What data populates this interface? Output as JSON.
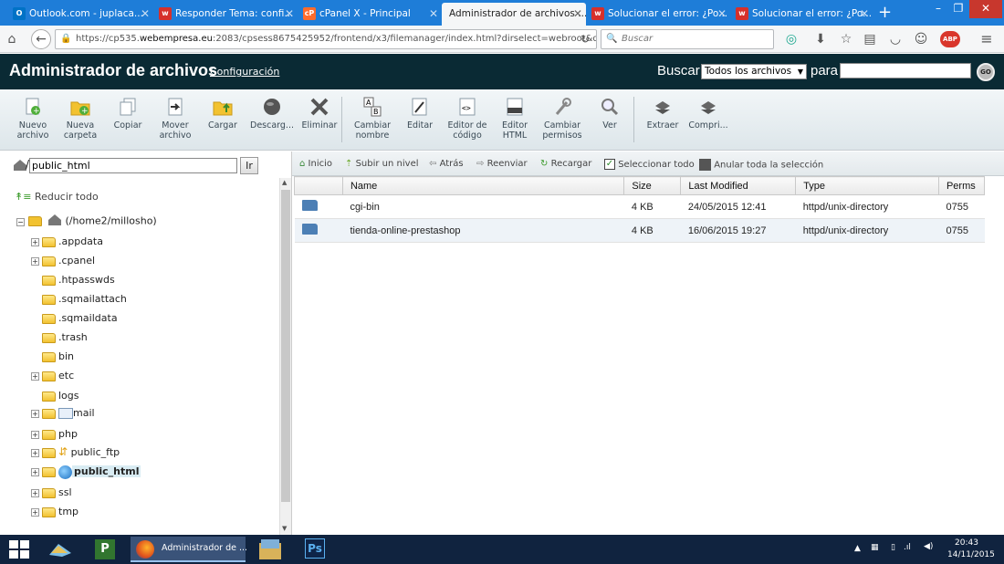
{
  "browser": {
    "tabs": [
      {
        "label": "Outlook.com - juplaca...",
        "favicon": "outlook-icon",
        "color": "#0072c6"
      },
      {
        "label": "Responder Tema: confi...",
        "favicon": "webempresa-icon",
        "color": "#d6302b"
      },
      {
        "label": "cPanel X - Principal",
        "favicon": "cpanel-icon",
        "color": "#ff6c2c"
      },
      {
        "label": "Administrador de archivos ...",
        "favicon": "none",
        "color": "#f5f6f7"
      },
      {
        "label": "Solucionar el error: ¿Po...",
        "favicon": "webempresa-icon",
        "color": "#d6302b"
      },
      {
        "label": "Solucionar el error: ¿Po...",
        "favicon": "webempresa-icon",
        "color": "#d6302b"
      }
    ],
    "url_prefix": "https://cp535.",
    "url_domain": "webempresa.eu",
    "url_suffix": ":2083/cpsess8675425952/frontend/x3/filemanager/index.html?dirselect=webroot&domainsele",
    "search_placeholder": "Buscar"
  },
  "header": {
    "title": "Administrador de archivos",
    "config_link": "Configuración",
    "search_label": "Buscar",
    "search_scope": "Todos los archivos",
    "search_para": "para",
    "go_label": "GO"
  },
  "toolbar": [
    {
      "label1": "Nuevo",
      "label2": "archivo",
      "icon": "new-file-icon"
    },
    {
      "label1": "Nueva",
      "label2": "carpeta",
      "icon": "new-folder-icon"
    },
    {
      "label1": "Copiar",
      "label2": "",
      "icon": "copy-icon"
    },
    {
      "label1": "Mover",
      "label2": "archivo",
      "icon": "move-icon"
    },
    {
      "label1": "Cargar",
      "label2": "",
      "icon": "upload-icon"
    },
    {
      "label1": "Descarg...",
      "label2": "",
      "icon": "download-icon"
    },
    {
      "label1": "Eliminar",
      "label2": "",
      "icon": "delete-icon"
    },
    {
      "label1": "Cambiar",
      "label2": "nombre",
      "icon": "rename-icon"
    },
    {
      "label1": "Editar",
      "label2": "",
      "icon": "edit-icon"
    },
    {
      "label1": "Editor de",
      "label2": "código",
      "icon": "code-editor-icon"
    },
    {
      "label1": "Editor",
      "label2": "HTML",
      "icon": "html-editor-icon"
    },
    {
      "label1": "Cambiar",
      "label2": "permisos",
      "icon": "permissions-icon"
    },
    {
      "label1": "Ver",
      "label2": "",
      "icon": "view-icon"
    },
    {
      "label1": "Extraer",
      "label2": "",
      "icon": "extract-icon"
    },
    {
      "label1": "Compri...",
      "label2": "",
      "icon": "compress-icon"
    }
  ],
  "left": {
    "path_value": "public_html",
    "go_button": "Ir",
    "collapse_all": "Reducir todo",
    "root_label": "(/home2/millosho)",
    "tree": [
      {
        "label": ".appdata",
        "expandable": true
      },
      {
        "label": ".cpanel",
        "expandable": true
      },
      {
        "label": ".htpasswds",
        "expandable": false
      },
      {
        "label": ".sqmailattach",
        "expandable": false
      },
      {
        "label": ".sqmaildata",
        "expandable": false
      },
      {
        "label": ".trash",
        "expandable": false
      },
      {
        "label": "bin",
        "expandable": false
      },
      {
        "label": "etc",
        "expandable": true
      },
      {
        "label": "logs",
        "expandable": false
      },
      {
        "label": "mail",
        "expandable": true
      },
      {
        "label": "php",
        "expandable": true
      },
      {
        "label": "public_ftp",
        "expandable": true
      },
      {
        "label": "public_html",
        "expandable": true,
        "selected": true
      },
      {
        "label": "ssl",
        "expandable": true
      },
      {
        "label": "tmp",
        "expandable": true
      }
    ]
  },
  "actions": {
    "home": "Inicio",
    "up": "Subir un nivel",
    "back": "Atrás",
    "forward": "Reenviar",
    "reload": "Recargar",
    "select_all": "Seleccionar todo",
    "unselect_all": "Anular toda la selección"
  },
  "table": {
    "columns": [
      "Name",
      "Size",
      "Last Modified",
      "Type",
      "Perms"
    ],
    "rows": [
      {
        "name": "cgi-bin",
        "size": "4 KB",
        "modified": "24/05/2015 12:41",
        "type": "httpd/unix-directory",
        "perms": "0755"
      },
      {
        "name": "tienda-online-prestashop",
        "size": "4 KB",
        "modified": "16/06/2015 19:27",
        "type": "httpd/unix-directory",
        "perms": "0755"
      }
    ]
  },
  "taskbar": {
    "active_window": "Administrador de ...",
    "time": "20:43",
    "date": "14/11/2015"
  }
}
